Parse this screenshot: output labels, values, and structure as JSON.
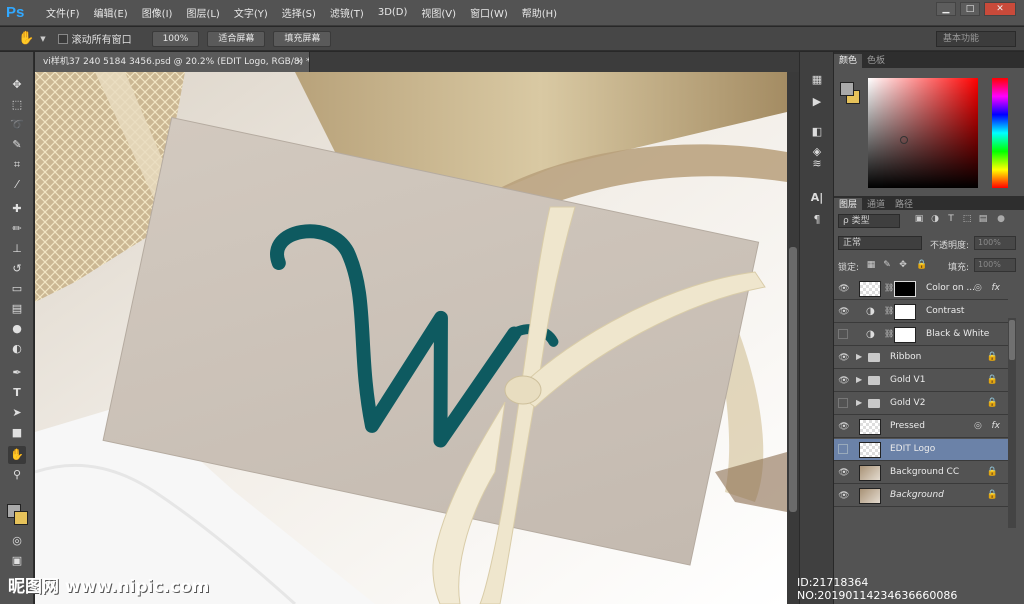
{
  "app": {
    "logo": "Ps"
  },
  "menu": [
    "文件(F)",
    "编辑(E)",
    "图像(I)",
    "图层(L)",
    "文字(Y)",
    "选择(S)",
    "滤镜(T)",
    "3D(D)",
    "视图(V)",
    "窗口(W)",
    "帮助(H)"
  ],
  "window_controls": {
    "minimize": "▁",
    "restore": "□",
    "close": "✕"
  },
  "options_bar": {
    "scroll_all_label": "滚动所有窗口",
    "zoom_100": "100%",
    "fit_screen": "适合屏幕",
    "fill_screen": "填充屏幕",
    "workspace": "基本功能"
  },
  "document": {
    "tab_title": "vi样机37 240 5184 3456.psd @ 20.2% (EDIT Logo, RGB/8) *",
    "close": "×"
  },
  "color_panel": {
    "tabs": [
      "颜色",
      "色板"
    ],
    "foreground": "#a9a9a9",
    "background": "#e6c25a"
  },
  "layers_panel": {
    "tabs": [
      "图层",
      "通道",
      "路径"
    ],
    "filter_kind": "ρ 类型",
    "blend_mode": "正常",
    "opacity_label": "不透明度:",
    "opacity_value": "100%",
    "lock_label": "锁定:",
    "fill_label": "填充:",
    "fill_value": "100%",
    "layers": [
      {
        "name": "Color on ...",
        "visible": true,
        "type": "smart-mask",
        "fx": "fx"
      },
      {
        "name": "Contrast",
        "visible": true,
        "type": "adjustment"
      },
      {
        "name": "Black & White",
        "visible": false,
        "type": "adjustment"
      },
      {
        "name": "Ribbon",
        "visible": true,
        "type": "group",
        "locked": true
      },
      {
        "name": "Gold V1",
        "visible": true,
        "type": "group",
        "locked": true
      },
      {
        "name": "Gold V2",
        "visible": false,
        "type": "group",
        "locked": true
      },
      {
        "name": "Pressed",
        "visible": true,
        "type": "smart",
        "fx": "fx"
      },
      {
        "name": "EDIT Logo",
        "visible": false,
        "type": "smart",
        "selected": true
      },
      {
        "name": "Background CC",
        "visible": true,
        "type": "image",
        "locked": true
      },
      {
        "name": "Background",
        "visible": true,
        "type": "image",
        "locked": true,
        "italic": true
      }
    ]
  },
  "watermark": {
    "site": "昵图网 www.nipic.com",
    "id_text": "ID:21718364 NO:20190114234636660086"
  },
  "colors": {
    "teal_logo": "#0e5a60",
    "card": "#cfc6bd",
    "ribbon": "#efe6cd",
    "selection": "#6b82a8"
  }
}
